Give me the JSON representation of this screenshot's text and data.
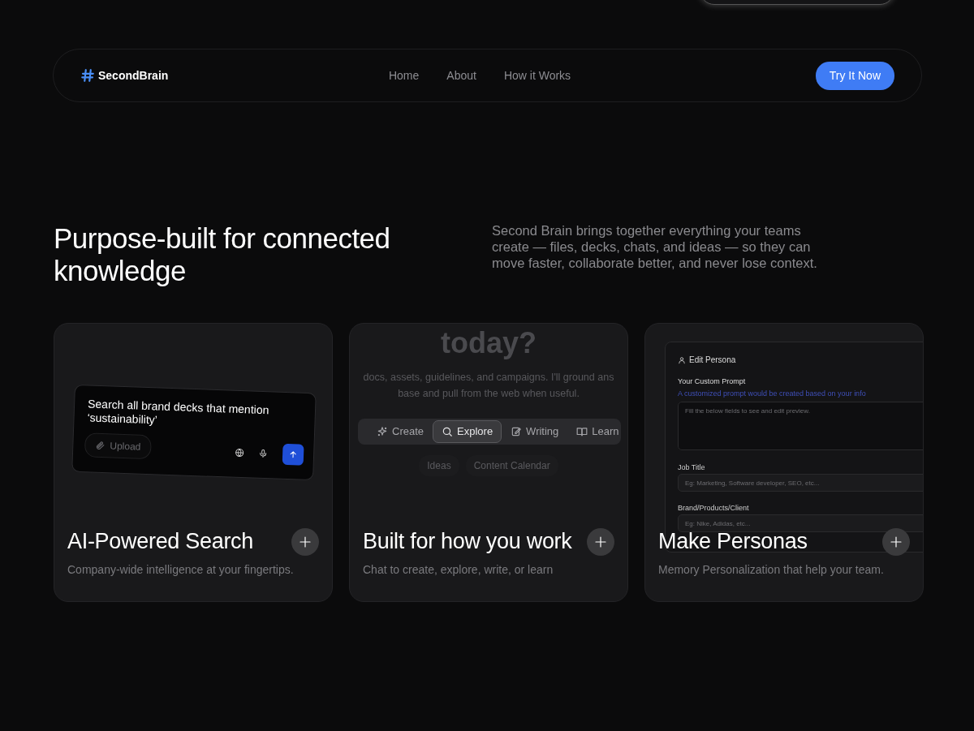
{
  "nav": {
    "brand": "SecondBrain",
    "links": [
      "Home",
      "About",
      "How it Works"
    ],
    "cta": "Try It Now"
  },
  "hero": {
    "title": "Purpose-built for connected knowledge",
    "description": "Second Brain brings together everything your teams create — files, decks, chats, and ideas — so they can move faster, collaborate better, and never lose context."
  },
  "cards": [
    {
      "kind": "search",
      "title": "AI-Powered Search",
      "subtitle": "Company-wide intelligence at your fingertips.",
      "preview": {
        "query": "Search all brand decks that mention ‘sustainability’",
        "upload": "Upload"
      }
    },
    {
      "kind": "modes",
      "title": "Built for how you work",
      "subtitle": "Chat to create, explore, write, or learn",
      "preview": {
        "heading": "today?",
        "lines": [
          "docs, assets, guidelines, and campaigns. I'll ground ans",
          "base and pull from the web when useful."
        ],
        "modes": [
          {
            "label": "Create",
            "selected": false
          },
          {
            "label": "Explore",
            "selected": true
          },
          {
            "label": "Writing",
            "selected": false
          },
          {
            "label": "Learn",
            "selected": false
          }
        ],
        "chips": [
          "Ideas",
          "Content Calendar"
        ]
      }
    },
    {
      "kind": "persona",
      "title": "Make Personas",
      "subtitle": "Memory Personalization that help your team.",
      "preview": {
        "heading": "Edit Persona",
        "prompt_label": "Your Custom Prompt",
        "prompt_hint": "A customized prompt would be created based on your info",
        "prompt_placeholder": "Fill the below fields to see and edit preview.",
        "fields": [
          {
            "label": "Job Title",
            "placeholder": "Eg: Marketing, Software developer, SEO, etc..."
          },
          {
            "label": "Brand/Products/Client",
            "placeholder": "Eg: Nike, Adidas, etc..."
          }
        ]
      }
    }
  ]
}
